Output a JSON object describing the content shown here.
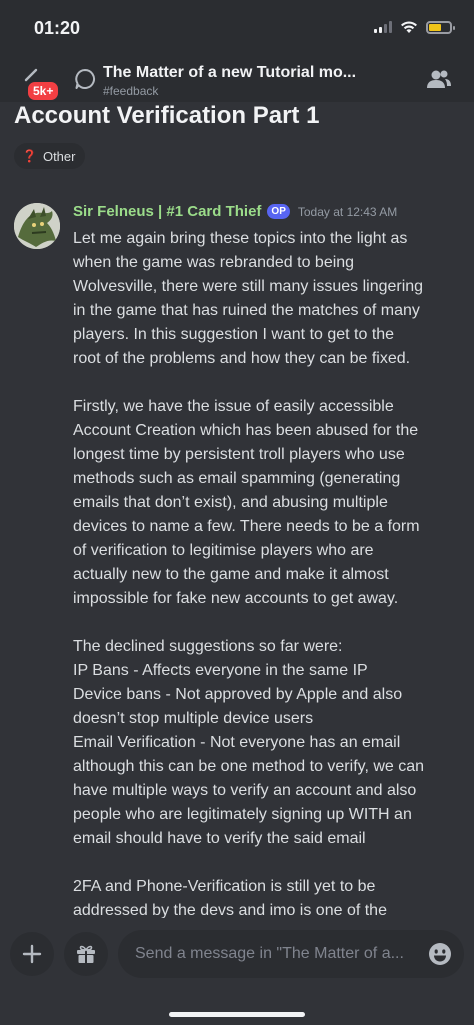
{
  "status_bar": {
    "time": "01:20"
  },
  "header": {
    "title": "The Matter of a new Tutorial mo...",
    "channel": "#feedback",
    "notification_badge": "5k+",
    "icons": [
      "back-icon",
      "thread-icon",
      "members-icon"
    ]
  },
  "thread": {
    "title": "Account Verification Part 1",
    "tag_icon": "❓",
    "tag_label": "Other"
  },
  "message": {
    "author": "Sir Felneus | #1 Card Thief",
    "op_badge": "OP",
    "timestamp": "Today at 12:43 AM",
    "author_color": "#9bdc8a",
    "paragraphs": [
      [
        "Let me again bring these topics into the light as",
        "when the game was rebranded to being",
        "Wolvesville, there were still many issues lingering",
        "in the game that has ruined the matches of many",
        "players. In this suggestion I want to get to the",
        "root of the problems and how they can be fixed."
      ],
      [
        "Firstly, we have the issue of easily accessible",
        "Account Creation which has been abused for the",
        "longest time by persistent troll players who use",
        "methods such as email spamming (generating",
        "emails that don’t exist), and abusing multiple",
        "devices to name a few. There needs to be a form",
        "of verification to legitimise players who are",
        "actually new to the game and make it almost",
        "impossible for fake new accounts to get away."
      ],
      [
        "The declined suggestions so far were:",
        "IP Bans - Affects everyone in the same IP",
        "Device bans - Not approved by Apple and also",
        "doesn’t stop multiple device users",
        "Email Verification - Not everyone has an email",
        "although this can be one method to verify, we can",
        "have multiple ways to verify an account and also",
        "people who are legitimately signing up WITH an",
        "email should have to verify the said email"
      ],
      [
        "2FA and Phone-Verification is still yet to be",
        "addressed by the devs and imo is one of the"
      ]
    ]
  },
  "composer": {
    "placeholder": "Send a message in \"The Matter of a...",
    "icons": [
      "plus-icon",
      "gift-icon",
      "emoji-icon"
    ]
  },
  "colors": {
    "background": "#313338",
    "header_bg": "#2b2d31",
    "badge": "#f23f43",
    "op_badge": "#5865f2"
  }
}
